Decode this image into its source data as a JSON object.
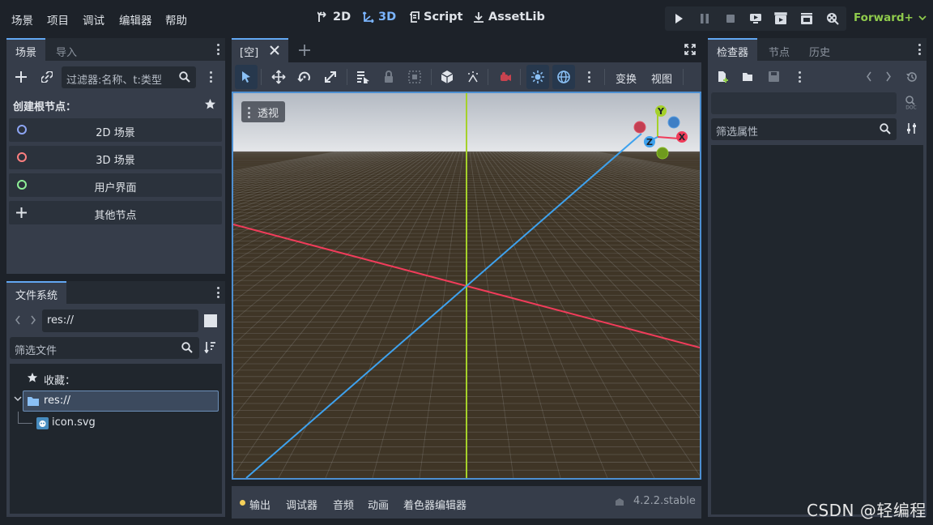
{
  "menu": [
    "场景",
    "项目",
    "调试",
    "编辑器",
    "帮助"
  ],
  "workspaces": {
    "w2d": "2D",
    "w3d": "3D",
    "script": "Script",
    "assetlib": "AssetLib"
  },
  "renderer": "Forward+",
  "scene_dock": {
    "tabs": [
      "场景",
      "导入"
    ],
    "filter_placeholder": "过滤器:名称、t:类型",
    "create_root_title": "创建根节点：",
    "root_options": [
      {
        "label": "2D 场景",
        "color": "#8da5f3"
      },
      {
        "label": "3D 场景",
        "color": "#fc7f7f"
      },
      {
        "label": "用户界面",
        "color": "#8eef97"
      },
      {
        "label": "其他节点"
      }
    ]
  },
  "filesystem_dock": {
    "tab": "文件系统",
    "path": "res://",
    "filter_placeholder": "筛选文件",
    "favorites_label": "收藏：",
    "root_folder": "res://",
    "files": [
      "icon.svg"
    ]
  },
  "editor": {
    "scene_tab": "[空]",
    "toolbar_menus": [
      "变换",
      "视图"
    ],
    "viewport_label": "透视",
    "gizmo_axes": {
      "x": "X",
      "y": "Y",
      "z": "Z"
    }
  },
  "bottom_panel": {
    "tabs": [
      "输出",
      "调试器",
      "音频",
      "动画",
      "着色器编辑器"
    ],
    "version": "4.2.2.stable"
  },
  "inspector_dock": {
    "tabs": [
      "检查器",
      "节点",
      "历史"
    ],
    "filter_placeholder": "筛选属性"
  },
  "watermark": "CSDN @轻编程",
  "colors": {
    "accent": "#62a7f2",
    "x_axis": "#f03c5a",
    "y_axis": "#a5d12a",
    "z_axis": "#3ea2ee"
  }
}
